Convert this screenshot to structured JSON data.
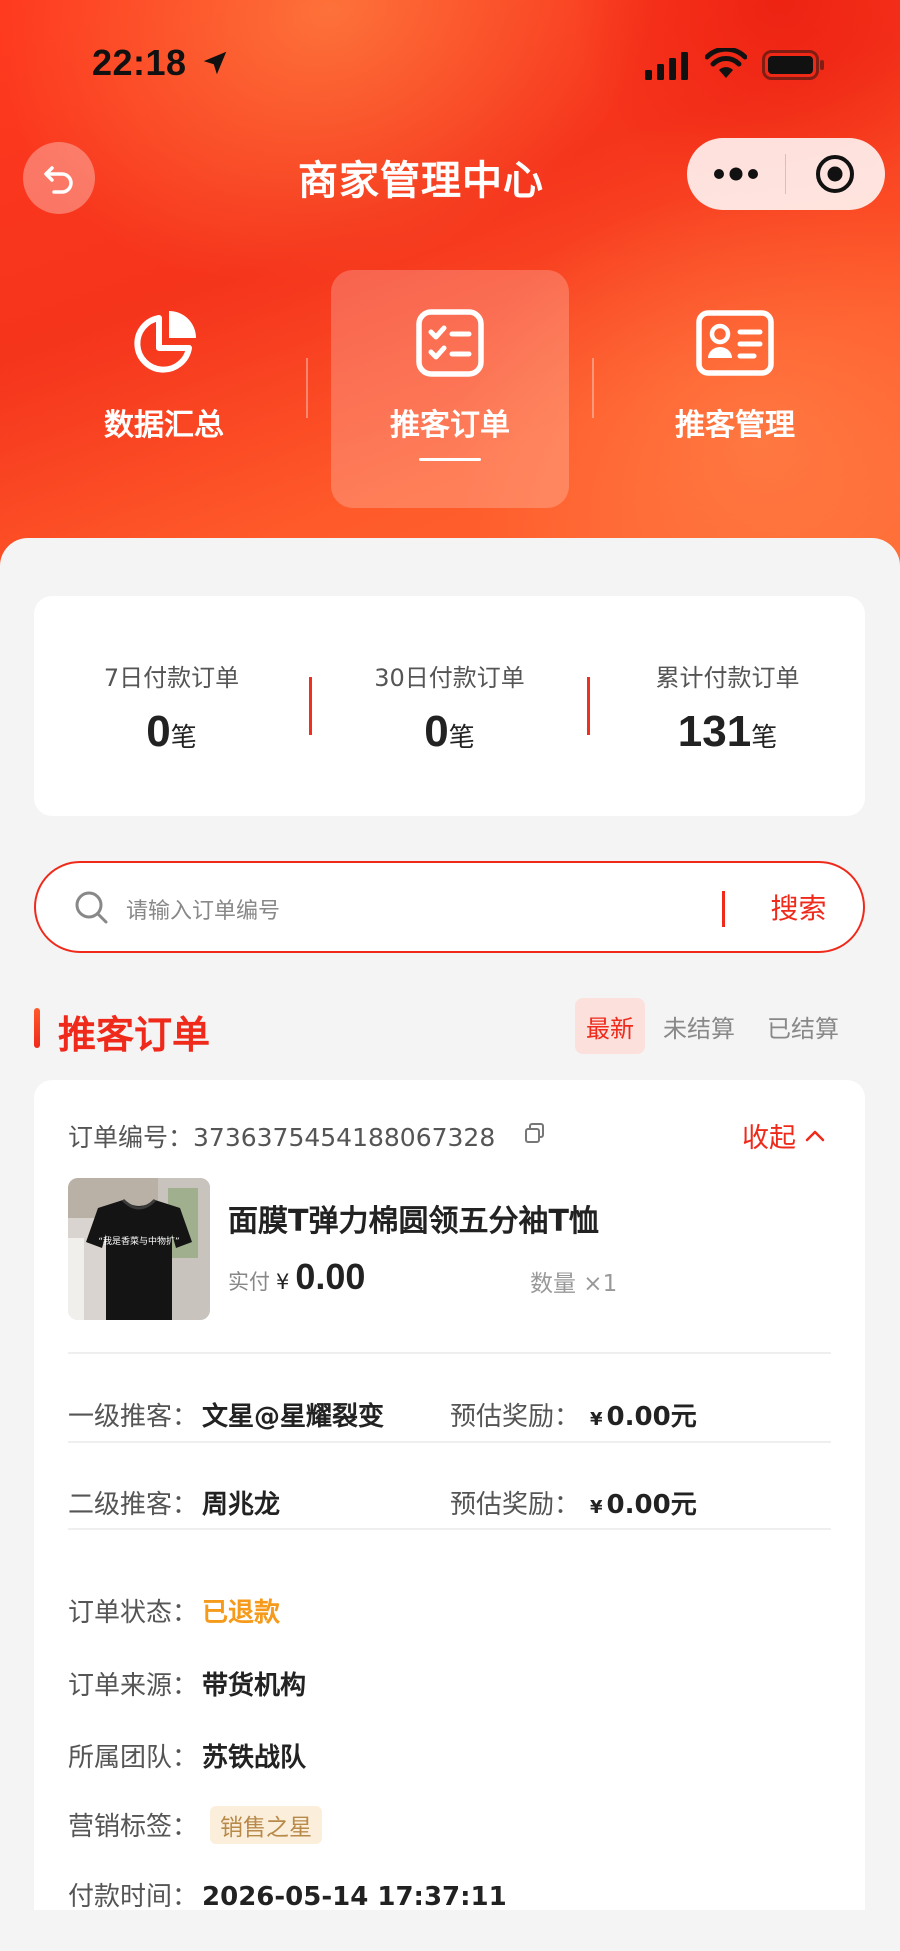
{
  "status_bar": {
    "time": "22:18"
  },
  "nav": {
    "title": "商家管理中心"
  },
  "tabs": [
    {
      "label": "数据汇总",
      "icon": "pie-chart-icon"
    },
    {
      "label": "推客订单",
      "icon": "checklist-icon"
    },
    {
      "label": "推客管理",
      "icon": "id-card-icon"
    }
  ],
  "stats": [
    {
      "label": "7日付款订单",
      "value": "0",
      "unit": "笔"
    },
    {
      "label": "30日付款订单",
      "value": "0",
      "unit": "笔"
    },
    {
      "label": "累计付款订单",
      "value": "131",
      "unit": "笔"
    }
  ],
  "search": {
    "placeholder": "请输入订单编号",
    "button": "搜索"
  },
  "section": {
    "title": "推客订单",
    "filters": [
      "最新",
      "未结算",
      "已结算"
    ]
  },
  "order": {
    "number_label": "订单编号：",
    "number": "3736375454188067328",
    "collapse_label": "收起",
    "product_name": "面膜T弹力棉圆领五分袖T恤",
    "paid_label": "实付",
    "currency": "¥",
    "paid_amount": "0.00",
    "qty_label": "数量 ×1",
    "image_text": "“我是香菜与中物扩”",
    "level1_label": "一级推客：",
    "level1_value": "文星@星耀裂变",
    "reward1_label": "预估奖励：",
    "reward1_value": "0.00元",
    "level2_label": "二级推客：",
    "level2_value": "周兆龙",
    "reward2_label": "预估奖励：",
    "reward2_value": "0.00元",
    "status_label": "订单状态：",
    "status_value": "已退款",
    "source_label": "订单来源：",
    "source_value": "带货机构",
    "team_label": "所属团队：",
    "team_value": "苏铁战队",
    "tag_label": "营销标签：",
    "tag_value": "销售之星",
    "paytime_label": "付款时间：",
    "paytime_value": "2026-05-14 17:37:11"
  },
  "colors": {
    "brand_red": "#ef2a1b",
    "refund_orange": "#f59a1b"
  }
}
